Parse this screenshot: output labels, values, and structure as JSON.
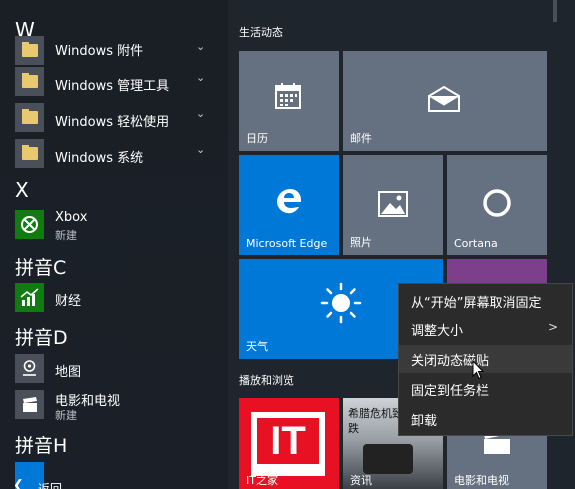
{
  "left": {
    "sections": [
      {
        "letter": "W"
      },
      {
        "letter": "X"
      },
      {
        "letter": "拼音C"
      },
      {
        "letter": "拼音D"
      },
      {
        "letter": "拼音H"
      }
    ],
    "apps": [
      {
        "label": "Windows 附件"
      },
      {
        "label": "Windows 管理工具"
      },
      {
        "label": "Windows 轻松使用"
      },
      {
        "label": "Windows 系统"
      },
      {
        "label": "Xbox",
        "sub": "新建"
      },
      {
        "label": "财经"
      },
      {
        "label": "地图"
      },
      {
        "label": "电影和电视",
        "sub": "新建"
      }
    ],
    "back_label": "返回"
  },
  "groups": {
    "life": "生活动态",
    "play": "播放和浏览"
  },
  "tiles": {
    "calendar": "日历",
    "mail": "邮件",
    "edge": "Microsoft Edge",
    "photos": "照片",
    "cortana": "Cortana",
    "weather": "天气",
    "itzhijia": "IT之家",
    "news_headline": "希腊危机致油价暴跌",
    "news_label": "资讯",
    "movies": "电影和电视",
    "it_logo": "IT"
  },
  "context_menu": {
    "items": [
      {
        "label": "从“开始”屏幕取消固定"
      },
      {
        "label": "调整大小"
      },
      {
        "label": "关闭动态磁贴"
      },
      {
        "label": "固定到任务栏"
      },
      {
        "label": "卸载"
      }
    ]
  },
  "colors": {
    "accent_blue": "#0078d7",
    "tile_gray": "#657080",
    "purple": "#7d3f8c",
    "red": "#e81123"
  }
}
